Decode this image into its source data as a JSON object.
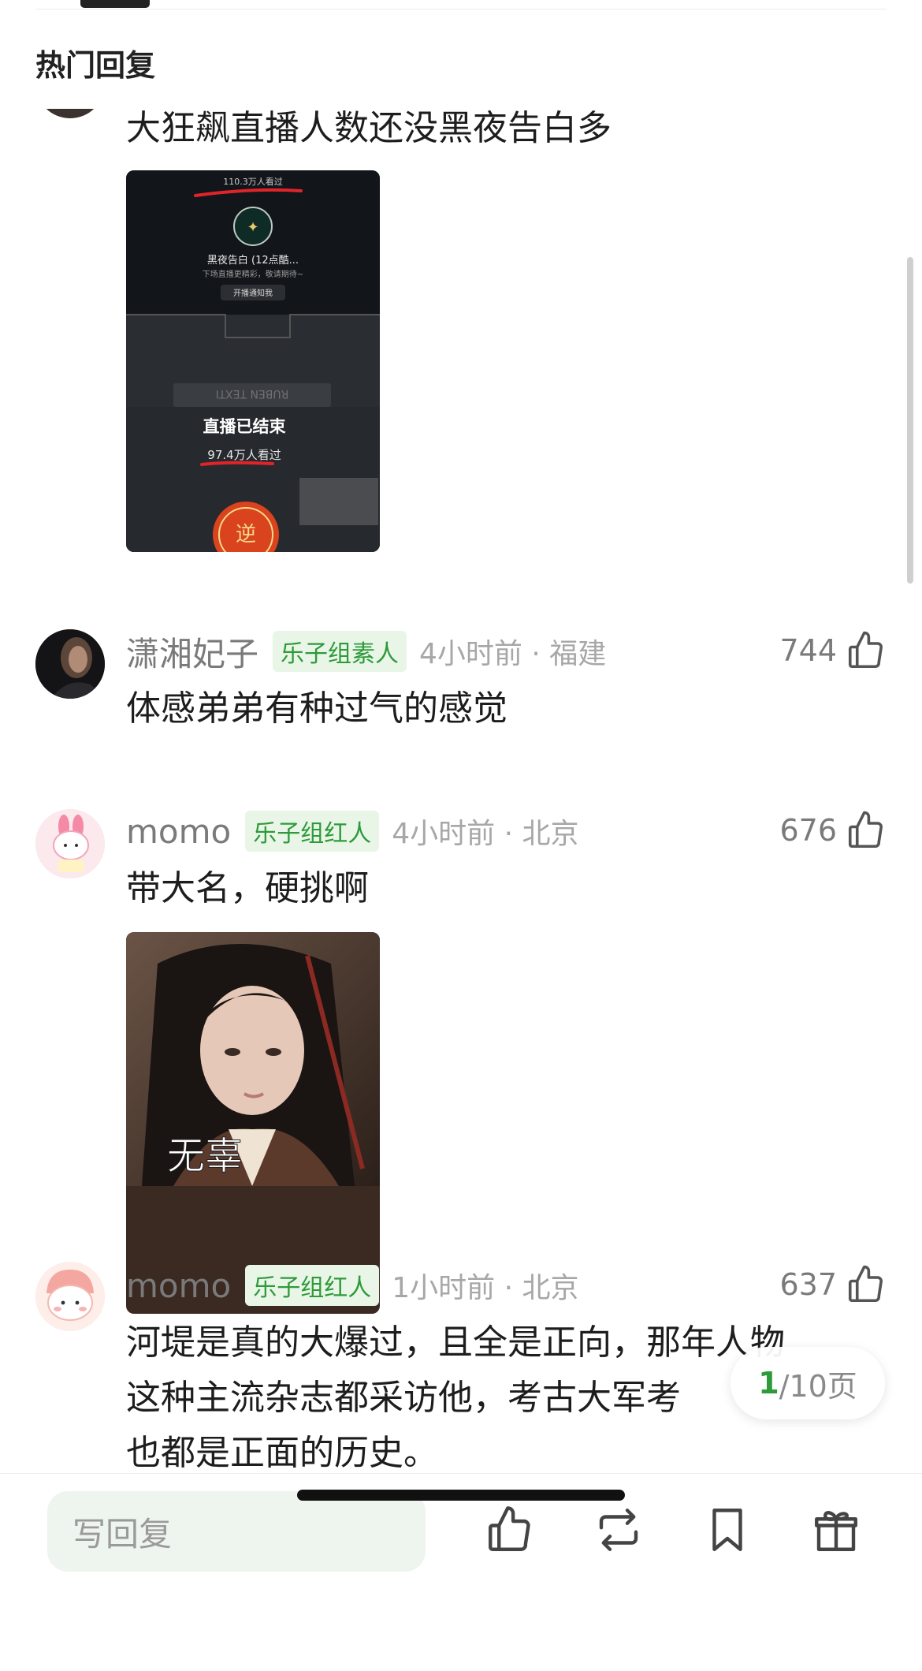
{
  "section_title": "热门回复",
  "comments": [
    {
      "text": "大狂飙直播人数还没黑夜告白多",
      "image": {
        "top_views": "110.3万人看过",
        "stream_title": "黑夜告白 (12点酷...",
        "stream_subtitle": "下场直播更精彩，敬请期待~",
        "notify_button": "开播通知我",
        "ended_label": "直播已结束",
        "ended_views": "97.4万人看过",
        "plate_text": "RUBEN TEXTI"
      }
    },
    {
      "username": "潇湘妃子",
      "badge": "乐子组素人",
      "time_location": "4小时前 · 福建",
      "likes": "744",
      "text": "体感弟弟有种过气的感觉"
    },
    {
      "username": "momo",
      "badge": "乐子组红人",
      "time_location": "4小时前 · 北京",
      "likes": "676",
      "text": "带大名，硬挑啊",
      "image": {
        "caption": "无辜"
      }
    },
    {
      "username": "momo",
      "badge": "乐子组红人",
      "time_location": "1小时前 · 北京",
      "likes": "637",
      "lines": [
        "河堤是真的大爆过，且全是正向，那年人物",
        "这种主流杂志都采访他，考古大军考",
        "也都是正面的历史。"
      ]
    }
  ],
  "pagination": {
    "current": "1",
    "total": "/10页"
  },
  "bottom_bar": {
    "reply_placeholder": "写回复"
  },
  "colors": {
    "accent_green": "#2e9a3a",
    "badge_bg": "#e9f6e7"
  }
}
